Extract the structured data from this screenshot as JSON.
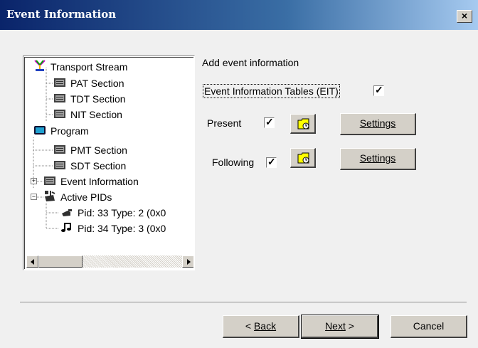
{
  "window": {
    "title": "Event Information",
    "close_label": "×"
  },
  "tree": {
    "items": [
      {
        "label": "Transport Stream",
        "icon": "transport-stream-icon"
      },
      {
        "label": "PAT Section",
        "icon": "section-icon"
      },
      {
        "label": "TDT Section",
        "icon": "section-icon"
      },
      {
        "label": "NIT Section",
        "icon": "section-icon"
      },
      {
        "label": "Program",
        "icon": "program-icon"
      },
      {
        "label": "PMT Section",
        "icon": "section-icon"
      },
      {
        "label": "SDT Section",
        "icon": "section-icon"
      },
      {
        "label": "Event Information",
        "icon": "section-icon",
        "expander": "+"
      },
      {
        "label": "Active PIDs",
        "icon": "pids-icon",
        "expander": "−"
      },
      {
        "label": "Pid: 33 Type: 2 (0x0",
        "icon": "video-icon"
      },
      {
        "label": "Pid: 34 Type: 3 (0x0",
        "icon": "audio-icon"
      }
    ]
  },
  "main": {
    "heading": "Add event information",
    "eit_label": "Event Information Tables (EIT)",
    "eit_checked": true,
    "present": {
      "label": "Present",
      "checked": true,
      "settings_label": "Settings"
    },
    "following": {
      "label": "Following",
      "checked": true,
      "settings_label": "Settings"
    }
  },
  "footer": {
    "back_label": "Back",
    "back_prefix": "< ",
    "next_label": "Next",
    "next_suffix": " >",
    "cancel_label": "Cancel"
  },
  "colors": {
    "title_bar": "#0a246a",
    "folder_yellow": "#ffff00"
  }
}
